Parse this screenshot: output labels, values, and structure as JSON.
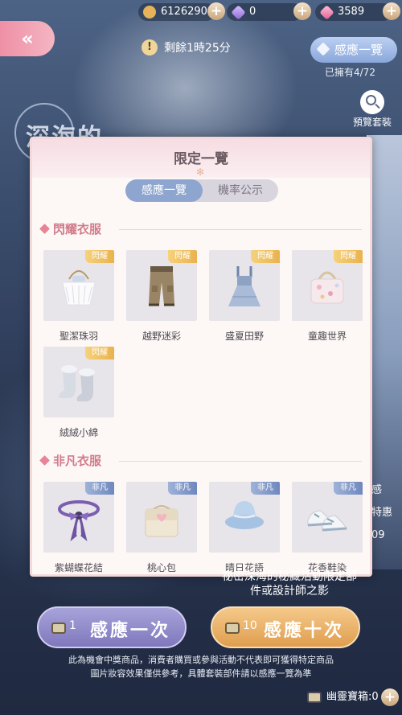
{
  "currencies": [
    {
      "name": "gold-coin",
      "value": "6126290"
    },
    {
      "name": "purple-diamond",
      "value": "0"
    },
    {
      "name": "pink-diamond",
      "value": "3589"
    }
  ],
  "timer": {
    "text": "剩餘1時25分"
  },
  "sense_overview": {
    "label": "感應一覽",
    "owned": "已擁有4/72"
  },
  "preview": {
    "label": "預覽套裝"
  },
  "background": {
    "title": "深海的",
    "side_text_1": "感",
    "side_text_2": "特惠",
    "side_text_3": "09"
  },
  "modal": {
    "title": "限定一覽",
    "tabs": [
      {
        "label": "感應一覽",
        "active": true
      },
      {
        "label": "機率公示",
        "active": false
      }
    ],
    "sections": [
      {
        "title": "閃耀衣服",
        "tag": "閃耀",
        "items": [
          {
            "name": "聖潔珠羽",
            "icon": "fur-handbag-icon"
          },
          {
            "name": "越野迷彩",
            "icon": "cargo-pants-icon"
          },
          {
            "name": "盛夏田野",
            "icon": "denim-overall-dress-icon"
          },
          {
            "name": "童趣世界",
            "icon": "floral-bag-icon"
          },
          {
            "name": "絨絨小綿",
            "icon": "fluffy-socks-icon"
          }
        ]
      },
      {
        "title": "非凡衣服",
        "tag": "非凡",
        "items": [
          {
            "name": "紫蝴蝶花結",
            "icon": "ribbon-choker-icon"
          },
          {
            "name": "桃心包",
            "icon": "heart-bag-icon"
          },
          {
            "name": "晴日花語",
            "icon": "bucket-hat-icon"
          },
          {
            "name": "花香鞋染",
            "icon": "sneakers-icon"
          }
        ]
      }
    ]
  },
  "bottom_info": "祕密深海的秘藏活動限定部件或設計師之影",
  "buttons": {
    "once": {
      "count": "1",
      "label": "感應一次"
    },
    "ten": {
      "count": "10",
      "label": "感應十次"
    }
  },
  "notes": [
    "此為機會中獎商品，消費者購買或參與活動不代表即可獲得特定商品",
    "圖片妝容效果僅供參考，具體套裝部件請以感應一覽為準"
  ],
  "chest": {
    "label": "幽靈寶箱:0"
  },
  "colors": {
    "accent_pink": "#e88497",
    "tab_active": "#8ea6cf",
    "gold_tag": "#e9b24e",
    "blue_tag": "#6f87bd"
  }
}
